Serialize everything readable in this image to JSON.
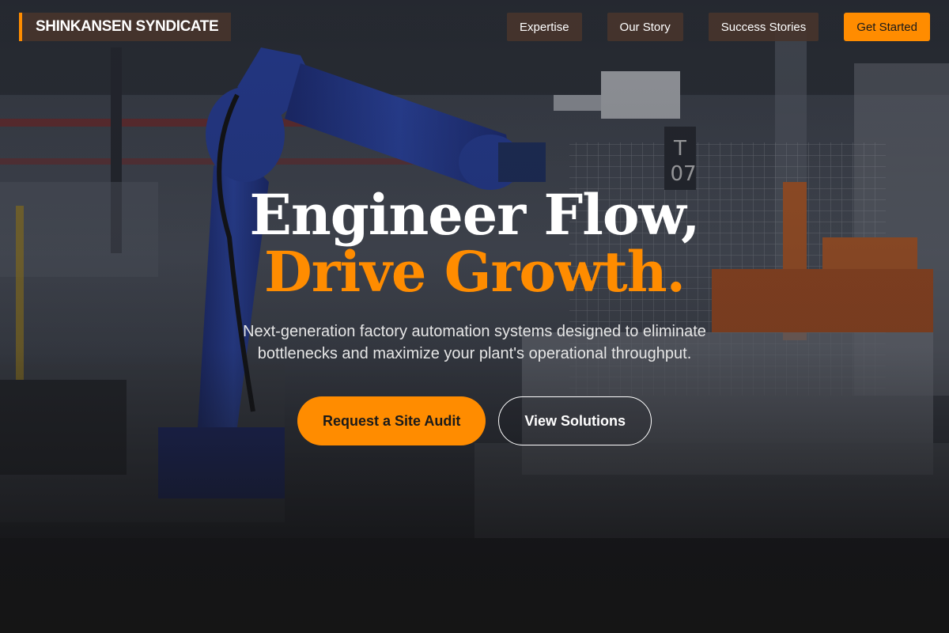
{
  "brand": {
    "name": "SHINKANSEN SYNDICATE"
  },
  "nav": {
    "links": [
      {
        "label": "Expertise"
      },
      {
        "label": "Our Story"
      },
      {
        "label": "Success Stories"
      }
    ],
    "cta_label": "Get Started"
  },
  "hero": {
    "headline_line1": "Engineer Flow,",
    "headline_line2": "Drive Growth.",
    "subtitle": "Next-generation factory automation systems designed to eliminate bottlenecks and maximize your plant's operational throughput.",
    "primary_button": "Request a Site Audit",
    "secondary_button": "View Solutions",
    "machine_tag_line1": "T",
    "machine_tag_line2": "07"
  },
  "colors": {
    "accent": "#ff8c00",
    "nav_bg": "#46342d",
    "text_light": "#ffffff",
    "robot_arm": "#2a47b8"
  }
}
